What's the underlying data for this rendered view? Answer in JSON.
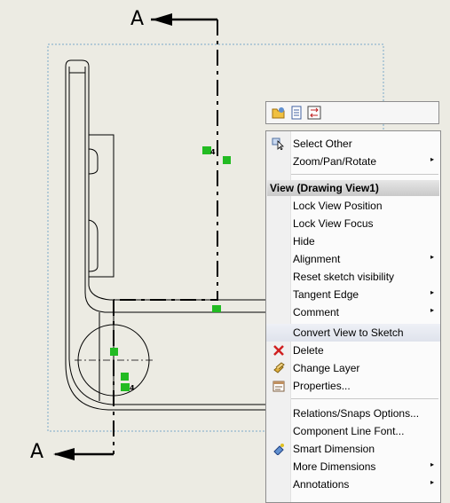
{
  "drawing": {
    "section_label_top": "A",
    "section_label_bottom": "A",
    "relation_tags": [
      "4",
      "4"
    ]
  },
  "toolbar": {
    "buttons": [
      "open-folder-icon",
      "properties-sheet-icon",
      "flip-arrows-icon"
    ]
  },
  "context_menu": {
    "items": [
      {
        "label": "Select Other",
        "icon": "select-other-icon"
      },
      {
        "label": "Zoom/Pan/Rotate",
        "submenu": true
      }
    ],
    "view_header": "View (Drawing View1)",
    "view_items": [
      {
        "label": "Lock View Position"
      },
      {
        "label": "Lock View Focus"
      },
      {
        "label": "Hide"
      },
      {
        "label": "Alignment",
        "submenu": true
      },
      {
        "label": "Reset sketch visibility"
      },
      {
        "label": "Tangent Edge",
        "submenu": true
      },
      {
        "label": "Comment",
        "submenu": true
      },
      {
        "label": "Convert View to Sketch",
        "highlighted": true
      }
    ],
    "edit_items": [
      {
        "label": "Delete",
        "icon": "delete-x-icon"
      },
      {
        "label": "Change Layer",
        "icon": "layer-icon"
      },
      {
        "label": "Properties...",
        "icon": "properties-icon"
      }
    ],
    "bottom_items": [
      {
        "label": "Relations/Snaps Options..."
      },
      {
        "label": "Component Line Font..."
      },
      {
        "label": "Smart Dimension",
        "icon": "smart-dimension-icon"
      },
      {
        "label": "More Dimensions",
        "submenu": true
      },
      {
        "label": "Annotations",
        "submenu": true
      }
    ],
    "colors": {
      "highlight": "#dfe3ec",
      "header": "#c9c9c9",
      "relation_green": "#22bb22"
    }
  }
}
